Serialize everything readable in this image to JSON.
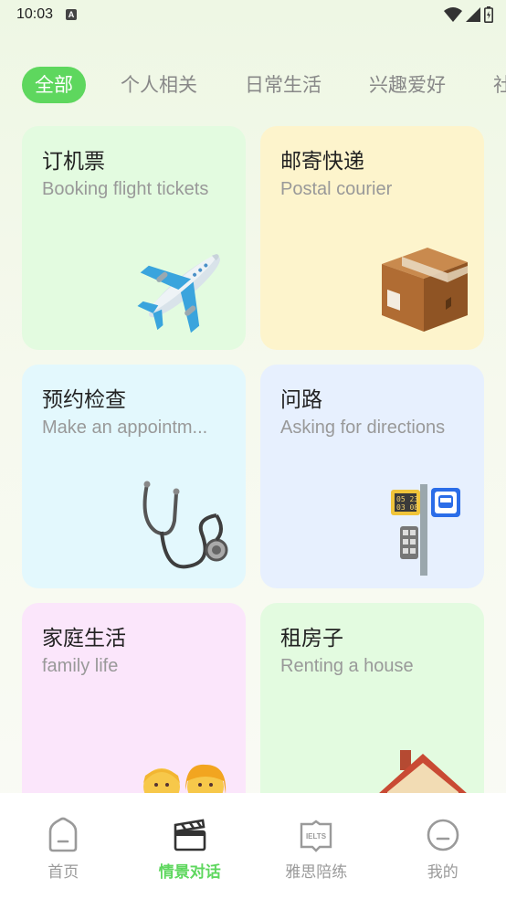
{
  "status": {
    "time": "10:03",
    "indicator": "A"
  },
  "tabs": [
    {
      "label": "全部",
      "active": true
    },
    {
      "label": "个人相关",
      "active": false
    },
    {
      "label": "日常生活",
      "active": false
    },
    {
      "label": "兴趣爱好",
      "active": false
    },
    {
      "label": "社",
      "active": false
    }
  ],
  "cards": [
    {
      "title": "订机票",
      "subtitle": "Booking flight tickets",
      "icon": "airplane-icon",
      "bg": "#e3fbe0"
    },
    {
      "title": "邮寄快递",
      "subtitle": "Postal courier",
      "icon": "package-icon",
      "bg": "#fdf4cc"
    },
    {
      "title": "预约检查",
      "subtitle": "Make an appointm...",
      "icon": "stethoscope-icon",
      "bg": "#e3f8fd"
    },
    {
      "title": "问路",
      "subtitle": "Asking for directions",
      "icon": "bus-stop-icon",
      "bg": "#e7f0fe"
    },
    {
      "title": "家庭生活",
      "subtitle": "family life",
      "icon": "family-icon",
      "bg": "#fbe6fb"
    },
    {
      "title": "租房子",
      "subtitle": "Renting a house",
      "icon": "house-icon",
      "bg": "#e3fbe0"
    }
  ],
  "nav": [
    {
      "label": "首页",
      "icon": "home-icon",
      "active": false
    },
    {
      "label": "情景对话",
      "icon": "clapperboard-icon",
      "active": true
    },
    {
      "label": "雅思陪练",
      "icon": "ielts-book-icon",
      "active": false,
      "badge": "IELTS"
    },
    {
      "label": "我的",
      "icon": "profile-icon",
      "active": false
    }
  ],
  "colors": {
    "accent": "#5ed75e"
  }
}
